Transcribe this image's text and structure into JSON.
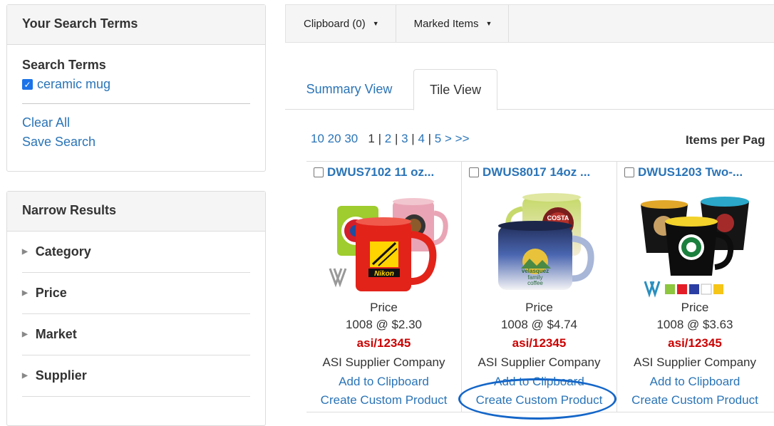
{
  "search_panel": {
    "title": "Your Search Terms",
    "terms_heading": "Search Terms",
    "term": "ceramic mug",
    "clear_all": "Clear All",
    "save_search": "Save Search"
  },
  "narrow_panel": {
    "title": "Narrow Results",
    "facets": [
      "Category",
      "Price",
      "Market",
      "Supplier"
    ]
  },
  "toolbar": {
    "clipboard": "Clipboard (0)",
    "marked": "Marked Items"
  },
  "tabs": {
    "summary": "Summary View",
    "tile": "Tile View"
  },
  "pager": {
    "per_page_options": [
      "10",
      "20",
      "30"
    ],
    "pages": [
      "1",
      "2",
      "3",
      "4",
      "5"
    ],
    "current": "1",
    "next": ">",
    "last": ">>",
    "items_per_page": "Items per Pag"
  },
  "products": [
    {
      "title": "DWUS7102  11 oz...",
      "price_label": "Price",
      "price": "1008 @ $2.30",
      "asi": "asi/12345",
      "supplier": "ASI Supplier Company",
      "add": "Add to Clipboard",
      "custom": "Create Custom Product"
    },
    {
      "title": "DWUS8017  14oz ...",
      "price_label": "Price",
      "price": "1008 @ $4.74",
      "asi": "asi/12345",
      "supplier": "ASI Supplier Company",
      "add": "Add to Clipboard",
      "custom": "Create Custom Product"
    },
    {
      "title": "DWUS1203  Two-...",
      "price_label": "Price",
      "price": "1008 @ $3.63",
      "asi": "asi/12345",
      "supplier": "ASI Supplier Company",
      "add": "Add to Clipboard",
      "custom": "Create Custom Product"
    }
  ],
  "colors": {
    "link": "#2a74b7",
    "asi_red": "#cc0000",
    "highlight_oval": "#1466c8"
  }
}
